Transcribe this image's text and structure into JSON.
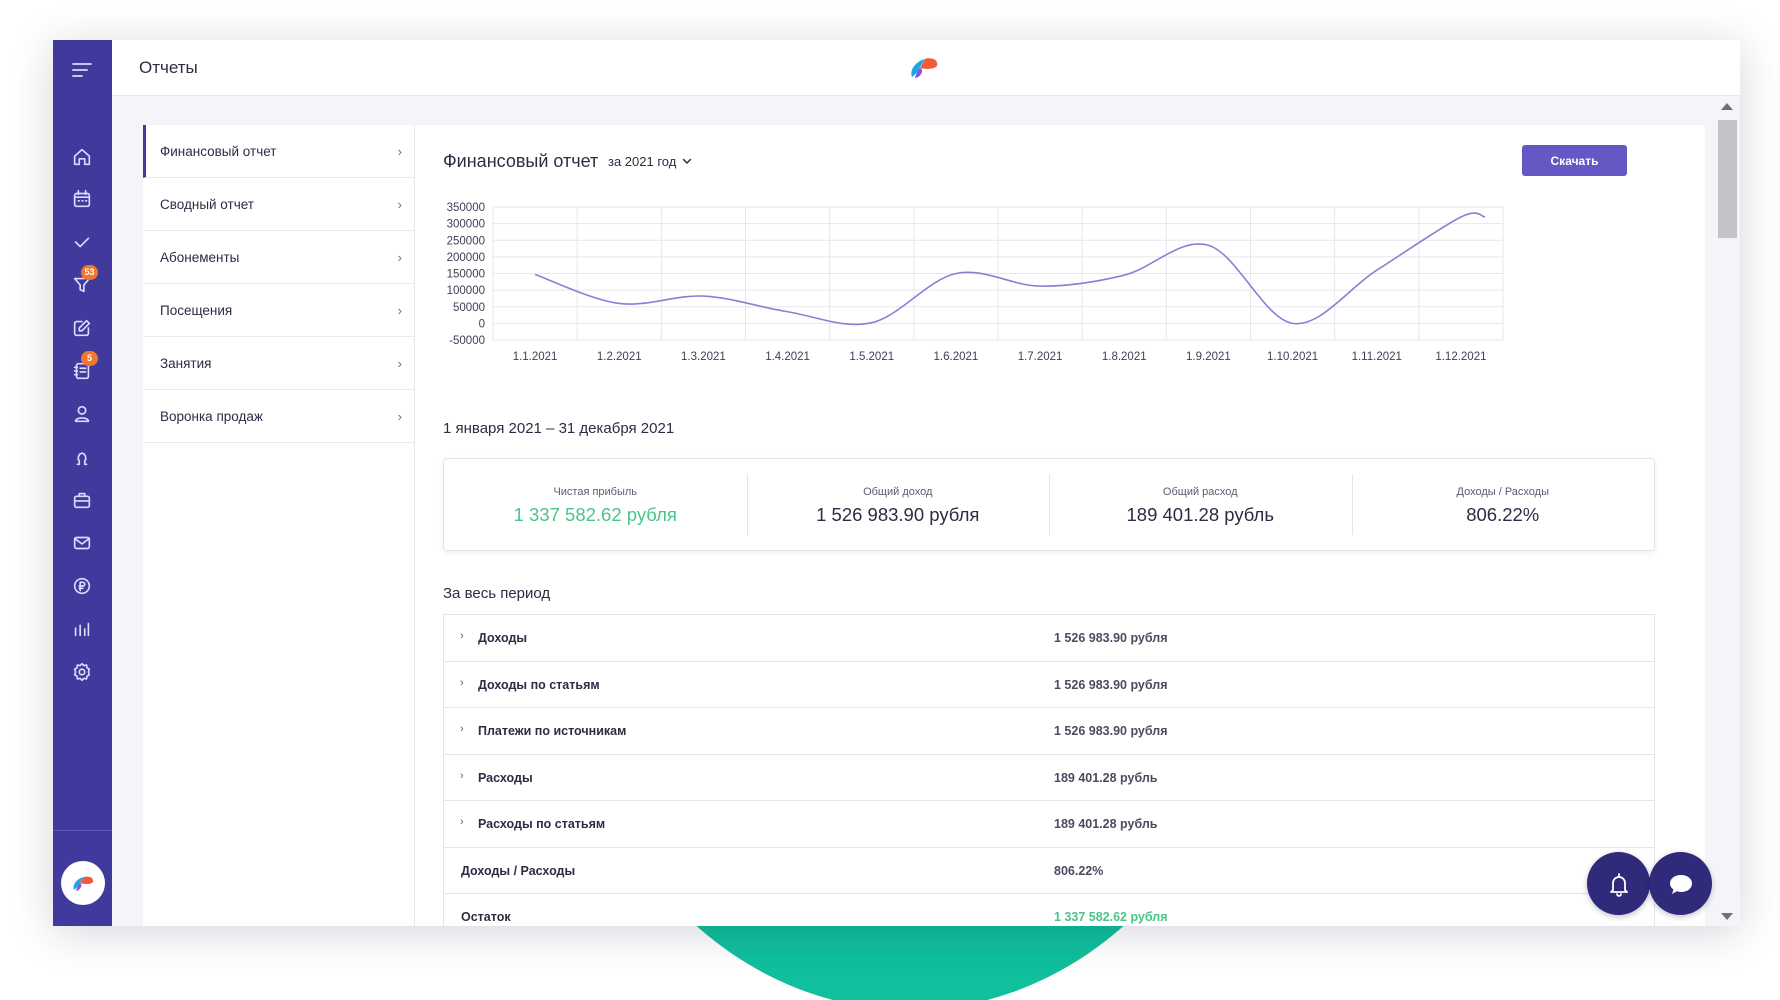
{
  "header": {
    "title": "Отчеты"
  },
  "rail": {
    "badges": {
      "funnel": "53",
      "journal": "5"
    }
  },
  "submenu": {
    "items": [
      {
        "label": "Финансовый отчет"
      },
      {
        "label": "Сводный отчет"
      },
      {
        "label": "Абонементы"
      },
      {
        "label": "Посещения"
      },
      {
        "label": "Занятия"
      },
      {
        "label": "Воронка продаж"
      }
    ]
  },
  "report": {
    "title": "Финансовый отчет",
    "period": "за 2021 год",
    "download_label": "Скачать",
    "date_range": "1 января 2021 – 31 декабря 2021",
    "summary": [
      {
        "caption": "Чистая прибыль",
        "value": "1 337 582.62 рубля"
      },
      {
        "caption": "Общий доход",
        "value": "1 526 983.90 рубля"
      },
      {
        "caption": "Общий расход",
        "value": "189 401.28 рубль"
      },
      {
        "caption": "Доходы / Расходы",
        "value": "806.22%"
      }
    ],
    "section_title": "За весь период",
    "rows": [
      {
        "label": "Доходы",
        "amount": "1 526 983.90 рубля"
      },
      {
        "label": "Доходы по статьям",
        "amount": "1 526 983.90 рубля"
      },
      {
        "label": "Платежи по источникам",
        "amount": "1 526 983.90 рубля"
      },
      {
        "label": "Расходы",
        "amount": "189 401.28 рубль"
      },
      {
        "label": "Расходы по статьям",
        "amount": "189 401.28 рубль"
      },
      {
        "label": "Доходы / Расходы",
        "amount": "806.22%"
      },
      {
        "label": "Остаток",
        "amount": "1 337 582.62 рубля"
      }
    ]
  },
  "colors": {
    "accent": "#3f3a9c",
    "button": "#6358c4",
    "positive": "#4bc48a",
    "line": "#8a7fd6",
    "teal_blob": "#10bf9c"
  },
  "chart_data": {
    "type": "line",
    "categories": [
      "1.1.2021",
      "1.2.2021",
      "1.3.2021",
      "1.4.2021",
      "1.5.2021",
      "1.6.2021",
      "1.7.2021",
      "1.8.2021",
      "1.9.2021",
      "1.10.2021",
      "1.11.2021",
      "1.12.2021"
    ],
    "series": [
      {
        "values": [
          147000,
          60000,
          82000,
          35000,
          2000,
          150000,
          112000,
          145000,
          235000,
          0,
          160000,
          320000
        ]
      }
    ],
    "y_ticks": [
      "350000",
      "300000",
      "250000",
      "200000",
      "150000",
      "100000",
      "50000",
      "0",
      "-50000"
    ],
    "ylim": [
      -50000,
      350000
    ],
    "grid": true,
    "legend": "none"
  }
}
